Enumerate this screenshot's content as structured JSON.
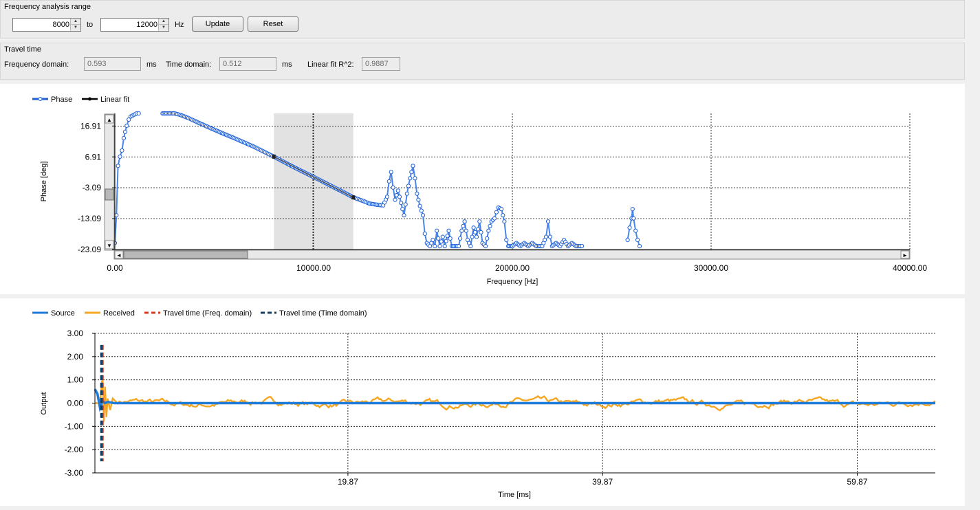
{
  "freq_range": {
    "title": "Frequency analysis range",
    "from_value": "8000",
    "to_label": "to",
    "to_value": "12000",
    "unit": "Hz",
    "update_label": "Update",
    "reset_label": "Reset"
  },
  "travel_time": {
    "title": "Travel time",
    "freq_label": "Frequency domain:",
    "freq_value": "0.593",
    "freq_unit": "ms",
    "time_label": "Time domain:",
    "time_value": "0.512",
    "time_unit": "ms",
    "fit_label": "Linear fit R^2:",
    "fit_value": "0.9887"
  },
  "chart_data": [
    {
      "type": "scatter",
      "xlabel": "Frequency [Hz]",
      "ylabel": "Phase [deg]",
      "xlim": [
        0,
        40000
      ],
      "ylim": [
        -23.09,
        21.0
      ],
      "x_ticks": [
        0,
        10000,
        20000,
        30000,
        40000
      ],
      "x_tick_labels": [
        "0.00",
        "10000.00",
        "20000.00",
        "30000.00",
        "40000.00"
      ],
      "y_ticks": [
        16.91,
        6.91,
        -3.09,
        -13.09,
        -23.09
      ],
      "y_tick_labels": [
        "16.91",
        "6.91",
        "-3.09",
        "-13.09",
        "-23.09"
      ],
      "grid": true,
      "legend_position": "top-left",
      "highlight_range": [
        8000,
        12000
      ],
      "colors": {
        "phase": "#1f5fd6",
        "fit": "#000000",
        "highlight": "#e2e2e2"
      },
      "series": [
        {
          "name": "Phase",
          "style": "markers-line",
          "points": [
            [
              0,
              -21
            ],
            [
              80,
              -12
            ],
            [
              160,
              4
            ],
            [
              260,
              7
            ],
            [
              360,
              9
            ],
            [
              450,
              13
            ],
            [
              520,
              15
            ],
            [
              600,
              17
            ],
            [
              700,
              19
            ],
            [
              800,
              20
            ],
            [
              950,
              20.5
            ],
            [
              1100,
              21
            ],
            [
              1200,
              21
            ],
            [
              2400,
              21
            ],
            [
              3000,
              21
            ],
            [
              3300,
              20.5
            ],
            [
              3700,
              19.5
            ],
            [
              4200,
              18
            ],
            [
              4800,
              16.3
            ],
            [
              5400,
              14.6
            ],
            [
              6000,
              13
            ],
            [
              6500,
              11.6
            ],
            [
              7000,
              10.2
            ],
            [
              7500,
              8.6
            ],
            [
              8000,
              7.0
            ],
            [
              8500,
              5.3
            ],
            [
              9000,
              3.6
            ],
            [
              9500,
              2.0
            ],
            [
              10000,
              0.4
            ],
            [
              10500,
              -1.2
            ],
            [
              11000,
              -2.9
            ],
            [
              11500,
              -4.5
            ],
            [
              12000,
              -6.2
            ],
            [
              12500,
              -7.4
            ],
            [
              12800,
              -8.2
            ],
            [
              13200,
              -8.6
            ],
            [
              13500,
              -8.8
            ],
            [
              13700,
              -6
            ],
            [
              13800,
              -1
            ],
            [
              13900,
              2
            ],
            [
              14000,
              -3
            ],
            [
              14100,
              -7
            ],
            [
              14250,
              -4
            ],
            [
              14400,
              -8
            ],
            [
              14550,
              -12
            ],
            [
              14700,
              -5
            ],
            [
              14850,
              0
            ],
            [
              15000,
              4
            ],
            [
              15100,
              0
            ],
            [
              15200,
              -5
            ],
            [
              15350,
              -9
            ],
            [
              15500,
              -12
            ],
            [
              15600,
              -18
            ],
            [
              15700,
              -21
            ],
            [
              15850,
              -22
            ],
            [
              16000,
              -20
            ],
            [
              16100,
              -22
            ],
            [
              16200,
              -17
            ],
            [
              16350,
              -22
            ],
            [
              16500,
              -19
            ],
            [
              16600,
              -22
            ],
            [
              16800,
              -17
            ],
            [
              16950,
              -22
            ],
            [
              17300,
              -22
            ],
            [
              17450,
              -17
            ],
            [
              17600,
              -14
            ],
            [
              17750,
              -20
            ],
            [
              17900,
              -22
            ],
            [
              18050,
              -16
            ],
            [
              18200,
              -19
            ],
            [
              18350,
              -14
            ],
            [
              18500,
              -21
            ],
            [
              18650,
              -22
            ],
            [
              18800,
              -17
            ],
            [
              18950,
              -14
            ],
            [
              19100,
              -13
            ],
            [
              19200,
              -11
            ],
            [
              19300,
              -9.5
            ],
            [
              19450,
              -10
            ],
            [
              19600,
              -14
            ],
            [
              19700,
              -20
            ],
            [
              19800,
              -22
            ],
            [
              20000,
              -22
            ],
            [
              20200,
              -21
            ],
            [
              20400,
              -22
            ],
            [
              20600,
              -21
            ],
            [
              20800,
              -22
            ],
            [
              21000,
              -21
            ],
            [
              21200,
              -22
            ],
            [
              21500,
              -22
            ],
            [
              21700,
              -19
            ],
            [
              21800,
              -14
            ],
            [
              21900,
              -19
            ],
            [
              22000,
              -22
            ],
            [
              22200,
              -21
            ],
            [
              22400,
              -22
            ],
            [
              22600,
              -20
            ],
            [
              22800,
              -22
            ],
            [
              23000,
              -21
            ],
            [
              23200,
              -22
            ],
            [
              23500,
              -22
            ],
            [
              25800,
              -20
            ],
            [
              25900,
              -16
            ],
            [
              26000,
              -13
            ],
            [
              26050,
              -10
            ],
            [
              26100,
              -13
            ],
            [
              26200,
              -17
            ],
            [
              26300,
              -20
            ],
            [
              26400,
              -22
            ]
          ]
        },
        {
          "name": "Linear fit",
          "style": "line",
          "points": [
            [
              8000,
              7.0
            ],
            [
              12000,
              -6.2
            ]
          ]
        }
      ]
    },
    {
      "type": "line",
      "xlabel": "Time [ms]",
      "ylabel": "Output",
      "xlim": [
        0,
        66
      ],
      "ylim": [
        -3.0,
        3.0
      ],
      "x_ticks": [
        19.87,
        39.87,
        59.87
      ],
      "x_tick_labels": [
        "19.87",
        "39.87",
        "59.87"
      ],
      "y_ticks": [
        3.0,
        2.0,
        1.0,
        0.0,
        -1.0,
        -2.0,
        -3.0
      ],
      "y_tick_labels": [
        "3.00",
        "2.00",
        "1.00",
        "0.00",
        "-1.00",
        "-2.00",
        "-3.00"
      ],
      "grid": true,
      "legend_position": "top-left",
      "colors": {
        "source": "#1f7ad8",
        "received": "#f5a623",
        "tt_freq": "#d93a1e",
        "tt_time": "#123e66"
      },
      "series": [
        {
          "name": "Source",
          "x": [
            0,
            0.2,
            0.4,
            0.6,
            0.8,
            1.0,
            1.5,
            66
          ],
          "values": [
            0.6,
            0.4,
            -0.2,
            0.1,
            0.0,
            0.05,
            0.0,
            0.0
          ]
        },
        {
          "name": "Received",
          "x": [
            0,
            0.4,
            0.6,
            0.7,
            0.8,
            0.9,
            1.0,
            1.2,
            1.4,
            1.8,
            66
          ],
          "values": [
            0.0,
            0.0,
            1.2,
            -0.8,
            0.7,
            -0.6,
            0.2,
            -0.3,
            0.2,
            0.0,
            0.0
          ]
        },
        {
          "name": "Travel time (Freq. domain)",
          "x": [
            0.593
          ],
          "values": [
            2.5
          ],
          "style": "vertical-dashed"
        },
        {
          "name": "Travel time (Time domain)",
          "x": [
            0.512
          ],
          "values": [
            2.5
          ],
          "style": "vertical-dashed"
        }
      ],
      "noise_amplitude": 0.15
    }
  ]
}
